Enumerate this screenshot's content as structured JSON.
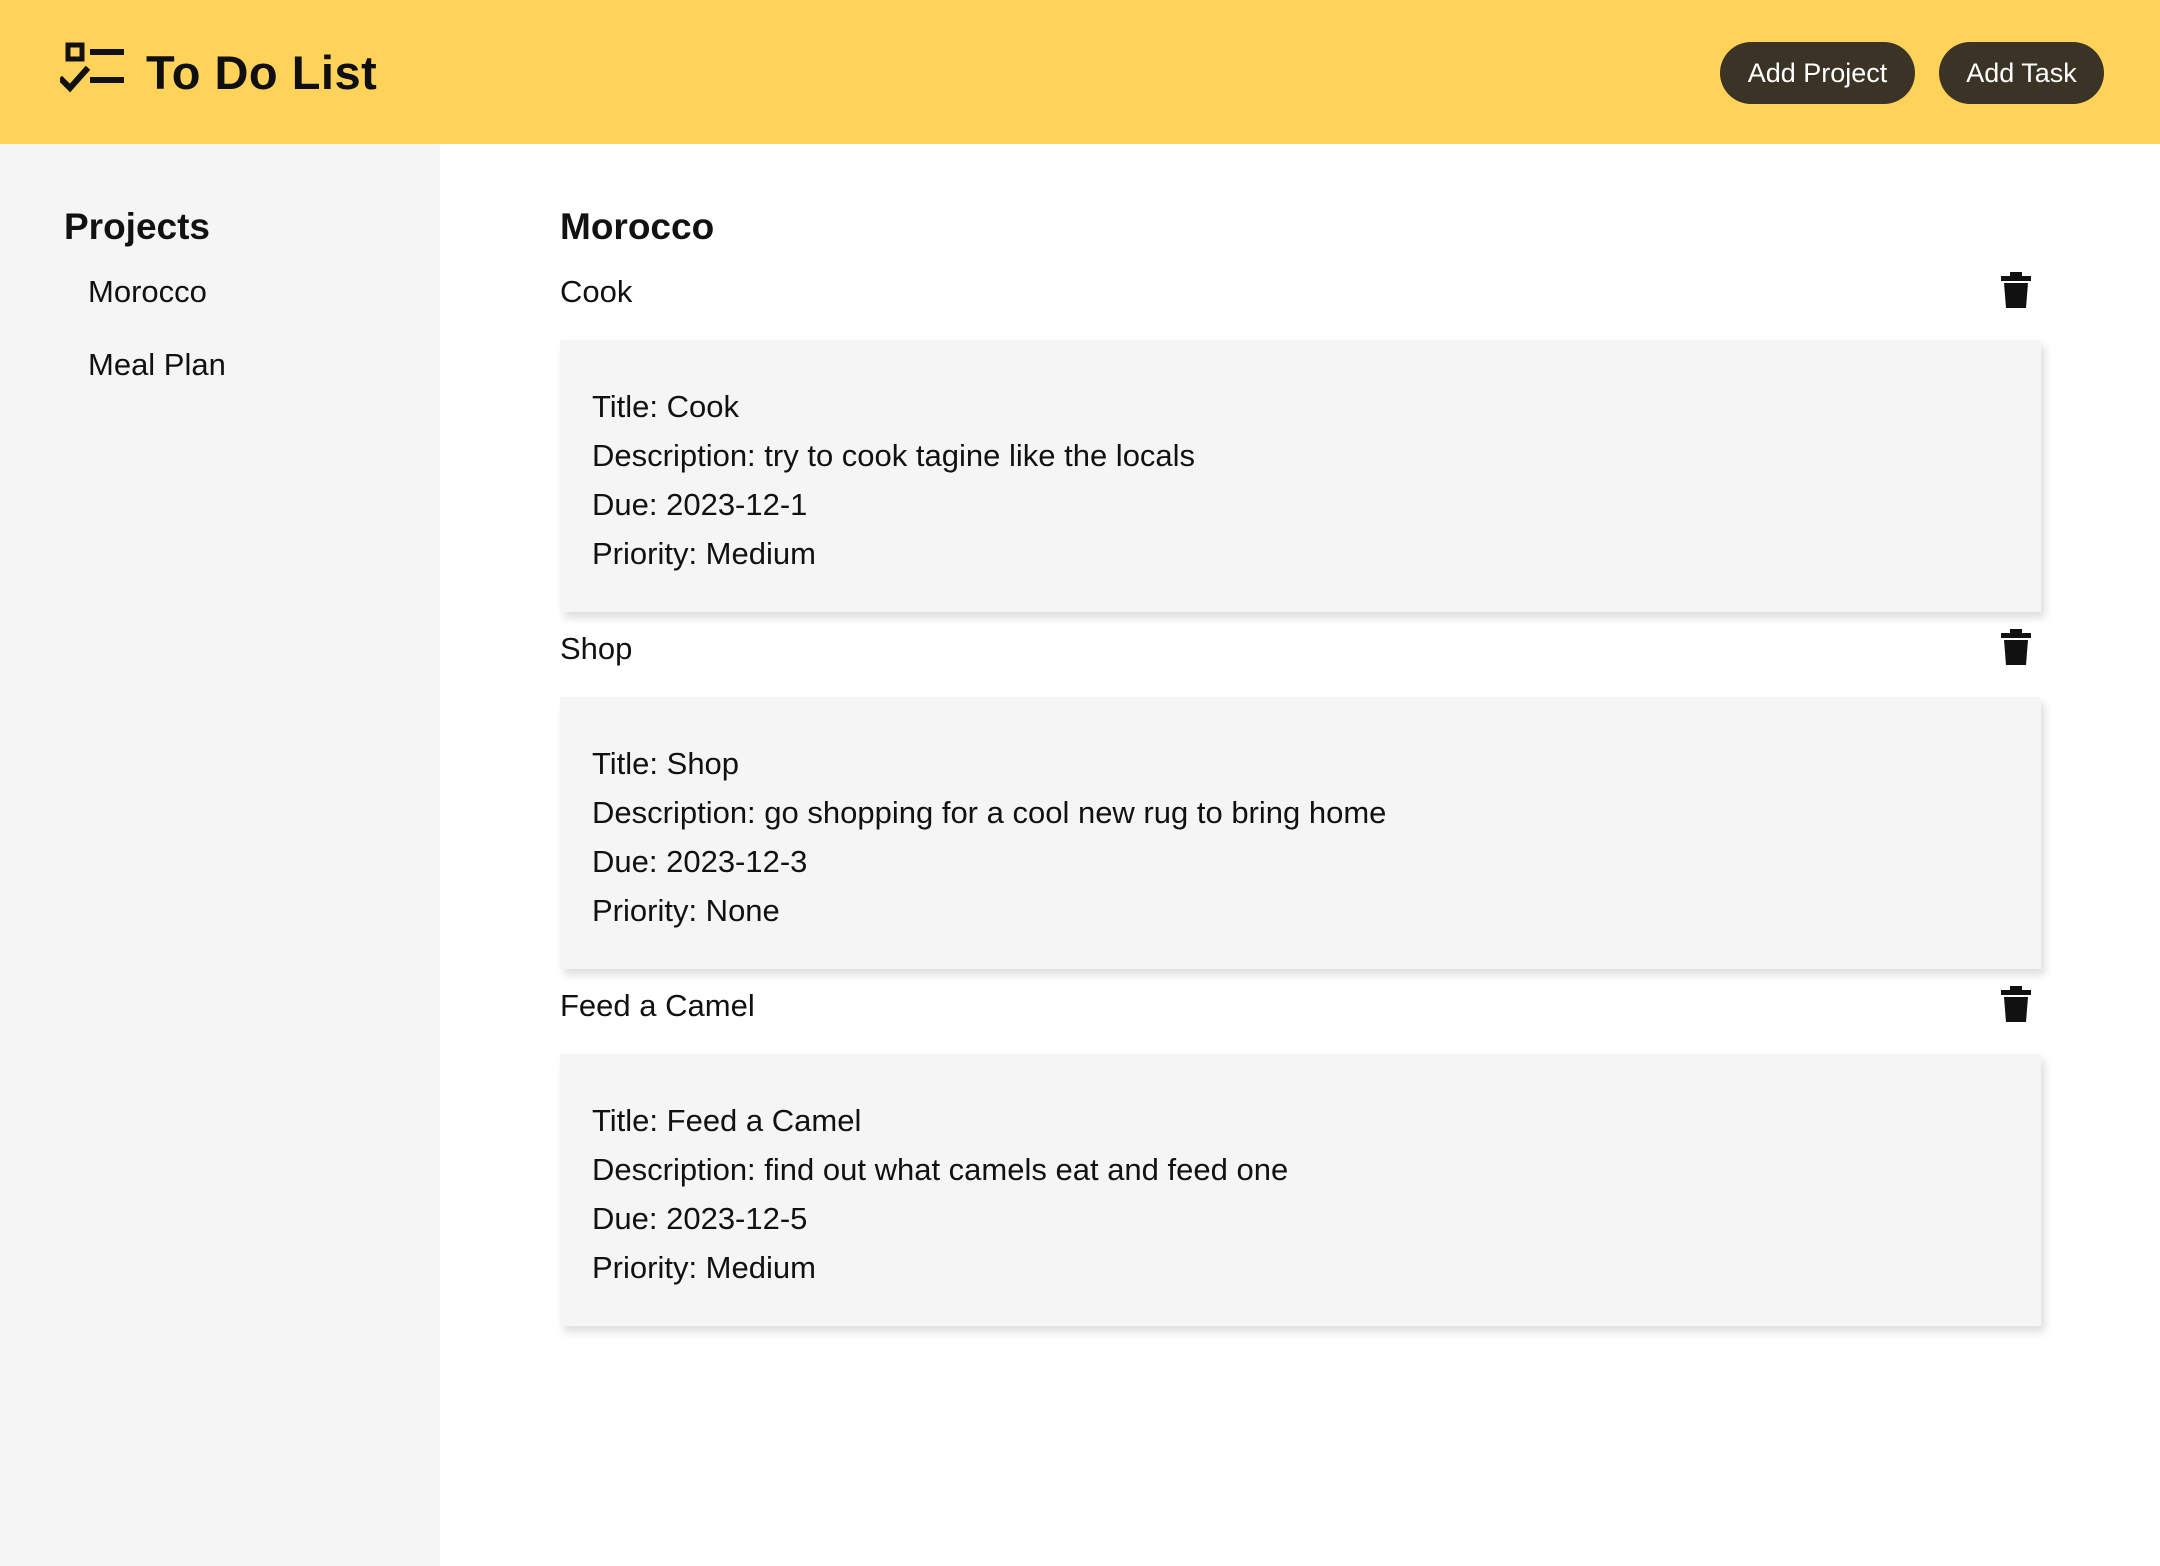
{
  "header": {
    "title": "To Do List",
    "logo_icon": "checklist-icon",
    "add_project_label": "Add Project",
    "add_task_label": "Add Task",
    "background": "#ffd35a",
    "button_color": "#3a3326"
  },
  "sidebar": {
    "title": "Projects",
    "items": [
      {
        "label": "Morocco"
      },
      {
        "label": "Meal Plan"
      }
    ]
  },
  "main": {
    "project_title": "Morocco",
    "tasks": [
      {
        "name": "Cook",
        "title_line": "Title: Cook",
        "description_line": "Description: try to cook tagine like the locals",
        "due_line": "Due: 2023-12-1",
        "priority_line": "Priority: Medium",
        "delete_icon": "trash-icon"
      },
      {
        "name": "Shop",
        "title_line": "Title: Shop",
        "description_line": "Description: go shopping for a cool new rug to bring home",
        "due_line": "Due: 2023-12-3",
        "priority_line": "Priority: None",
        "delete_icon": "trash-icon"
      },
      {
        "name": "Feed a Camel",
        "title_line": "Title: Feed a Camel",
        "description_line": "Description: find out what camels eat and feed one",
        "due_line": "Due: 2023-12-5",
        "priority_line": "Priority: Medium",
        "delete_icon": "trash-icon"
      }
    ]
  }
}
